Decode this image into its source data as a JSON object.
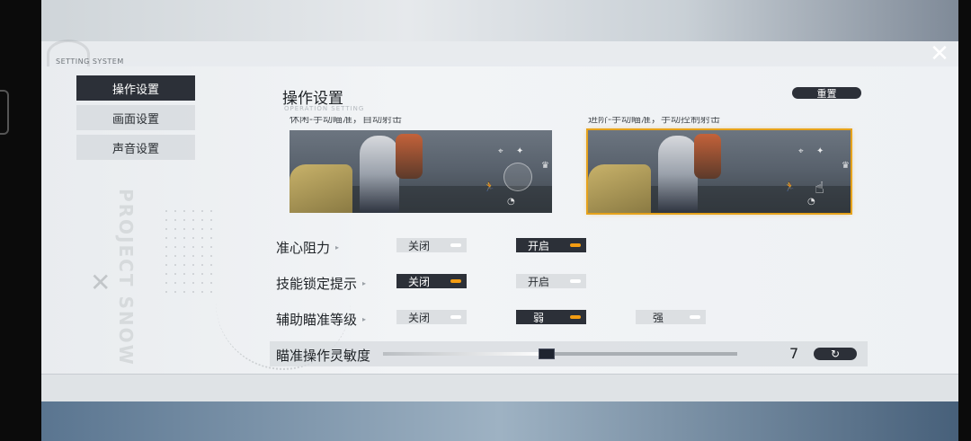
{
  "header": {
    "system_label": "SETTING SYSTEM",
    "close_icon": "close-x-icon"
  },
  "sidebar": {
    "items": [
      {
        "label": "操作设置",
        "active": true
      },
      {
        "label": "画面设置",
        "active": false
      },
      {
        "label": "声音设置",
        "active": false
      }
    ]
  },
  "main": {
    "title": "操作设置",
    "subtitle": "OPERATION SETTING",
    "reset_label": "重置",
    "modes": [
      {
        "caption": "休闲-手动瞄准，自动射击",
        "selected": false
      },
      {
        "caption": "进阶-手动瞄准，手动控制射击",
        "selected": true
      }
    ],
    "options": [
      {
        "label": "准心阻力",
        "choices": [
          "关闭",
          "开启"
        ],
        "selected": 1
      },
      {
        "label": "技能锁定提示",
        "choices": [
          "关闭",
          "开启"
        ],
        "selected": 0
      },
      {
        "label": "辅助瞄准等级",
        "choices": [
          "关闭",
          "弱",
          "强"
        ],
        "selected": 1
      }
    ],
    "sensitivity": {
      "label": "瞄准操作灵敏度",
      "value": "7",
      "fraction": 0.46,
      "reset_icon": "refresh-icon"
    }
  },
  "colors": {
    "accent": "#f39c12",
    "dark": "#2c3038",
    "selected_outline": "#e6a21b"
  }
}
